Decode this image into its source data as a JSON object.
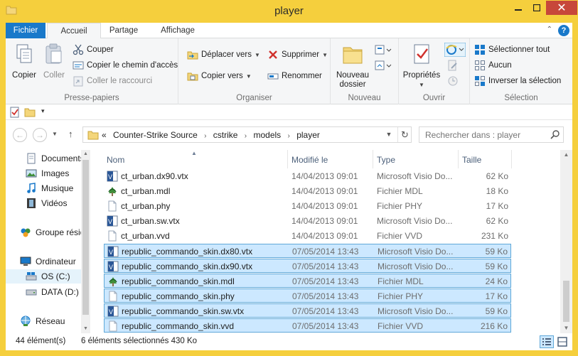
{
  "window": {
    "title": "player"
  },
  "ribbon": {
    "tabs": {
      "file": "Fichier",
      "home": "Accueil",
      "share": "Partage",
      "view": "Affichage"
    },
    "clipboard": {
      "copy": "Copier",
      "paste": "Coller",
      "cut": "Couper",
      "copy_path": "Copier le chemin d'accès",
      "paste_shortcut": "Coller le raccourci",
      "label": "Presse-papiers"
    },
    "organize": {
      "move_to": "Déplacer vers",
      "copy_to": "Copier vers",
      "delete": "Supprimer",
      "rename": "Renommer",
      "label": "Organiser"
    },
    "new": {
      "new_folder_line1": "Nouveau",
      "new_folder_line2": "dossier",
      "label": "Nouveau"
    },
    "open": {
      "properties": "Propriétés",
      "label": "Ouvrir"
    },
    "select": {
      "select_all": "Sélectionner tout",
      "select_none": "Aucun",
      "invert": "Inverser la sélection",
      "label": "Sélection"
    }
  },
  "address": {
    "prefix": "«",
    "crumbs": [
      "Counter-Strike Source",
      "cstrike",
      "models",
      "player"
    ],
    "search_placeholder": "Rechercher dans : player"
  },
  "navpane": {
    "items": [
      {
        "label": "Documents",
        "icon": "documents-icon"
      },
      {
        "label": "Images",
        "icon": "pictures-icon"
      },
      {
        "label": "Musique",
        "icon": "music-icon"
      },
      {
        "label": "Vidéos",
        "icon": "videos-icon"
      },
      {
        "label": "Groupe résidentiel",
        "icon": "homegroup-icon"
      },
      {
        "label": "Ordinateur",
        "icon": "computer-icon"
      },
      {
        "label": "OS (C:)",
        "icon": "drive-c-icon"
      },
      {
        "label": "DATA (D:)",
        "icon": "drive-d-icon"
      },
      {
        "label": "Réseau",
        "icon": "network-icon"
      }
    ]
  },
  "columns": {
    "name": "Nom",
    "modified": "Modifié le",
    "type": "Type",
    "size": "Taille"
  },
  "files": [
    {
      "name": "ct_urban.dx90.vtx",
      "modified": "14/04/2013 09:01",
      "type": "Microsoft Visio Do...",
      "size": "62 Ko",
      "icon": "visio",
      "selected": false
    },
    {
      "name": "ct_urban.mdl",
      "modified": "14/04/2013 09:01",
      "type": "Fichier MDL",
      "size": "18 Ko",
      "icon": "mdl",
      "selected": false
    },
    {
      "name": "ct_urban.phy",
      "modified": "14/04/2013 09:01",
      "type": "Fichier PHY",
      "size": "17 Ko",
      "icon": "blank",
      "selected": false
    },
    {
      "name": "ct_urban.sw.vtx",
      "modified": "14/04/2013 09:01",
      "type": "Microsoft Visio Do...",
      "size": "62 Ko",
      "icon": "visio",
      "selected": false
    },
    {
      "name": "ct_urban.vvd",
      "modified": "14/04/2013 09:01",
      "type": "Fichier VVD",
      "size": "231 Ko",
      "icon": "blank",
      "selected": false
    },
    {
      "name": "republic_commando_skin.dx80.vtx",
      "modified": "07/05/2014 13:43",
      "type": "Microsoft Visio Do...",
      "size": "59 Ko",
      "icon": "visio",
      "selected": true
    },
    {
      "name": "republic_commando_skin.dx90.vtx",
      "modified": "07/05/2014 13:43",
      "type": "Microsoft Visio Do...",
      "size": "59 Ko",
      "icon": "visio",
      "selected": true
    },
    {
      "name": "republic_commando_skin.mdl",
      "modified": "07/05/2014 13:43",
      "type": "Fichier MDL",
      "size": "24 Ko",
      "icon": "mdl",
      "selected": true
    },
    {
      "name": "republic_commando_skin.phy",
      "modified": "07/05/2014 13:43",
      "type": "Fichier PHY",
      "size": "17 Ko",
      "icon": "blank",
      "selected": true
    },
    {
      "name": "republic_commando_skin.sw.vtx",
      "modified": "07/05/2014 13:43",
      "type": "Microsoft Visio Do...",
      "size": "59 Ko",
      "icon": "visio",
      "selected": true
    },
    {
      "name": "republic_commando_skin.vvd",
      "modified": "07/05/2014 13:43",
      "type": "Fichier VVD",
      "size": "216 Ko",
      "icon": "blank",
      "selected": true
    }
  ],
  "status": {
    "count": "44 élément(s)",
    "selection": "6 éléments sélectionnés  430 Ko"
  },
  "colors": {
    "accent": "#1979ca",
    "frame": "#f5cf3d",
    "selection_bg": "#cce8ff",
    "selection_border": "#5fa8d8"
  }
}
